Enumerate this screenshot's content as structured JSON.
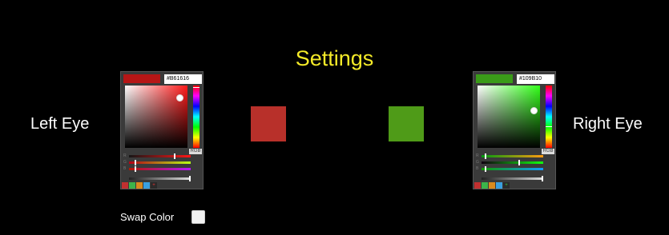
{
  "title": "Settings",
  "left": {
    "label": "Left Eye",
    "color": "#B61616",
    "hex_text": "#B61616",
    "hue_color": "#ff1a1a",
    "mode_label": "RGB",
    "swatch_color": "#b8302a"
  },
  "right": {
    "label": "Right Eye",
    "color": "#109B10",
    "hex_text": "#109B10",
    "hue_color": "#33ff1a",
    "mode_label": "RGB",
    "swatch_color": "#4f9b18"
  },
  "preset_colors": [
    "#c03030",
    "#3cb44a",
    "#d98a1e",
    "#3aa0e0"
  ],
  "swap": {
    "label": "Swap Color",
    "checked": false
  }
}
